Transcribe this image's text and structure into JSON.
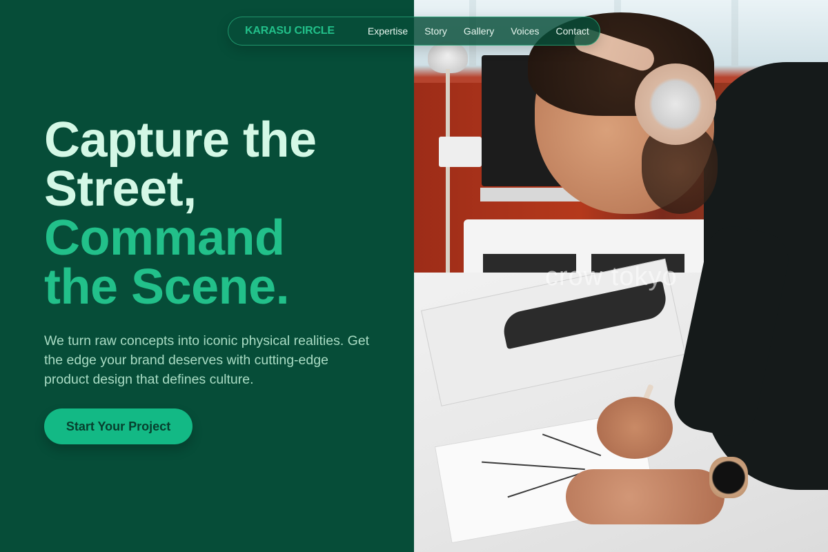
{
  "nav": {
    "brand": "KARASU CIRCLE",
    "links": [
      "Expertise",
      "Story",
      "Gallery",
      "Voices",
      "Contact"
    ]
  },
  "hero": {
    "title_line1": "Capture the",
    "title_line2": "Street,",
    "title_accent_line1": "Command",
    "title_accent_line2": "the Scene.",
    "description": "We turn raw concepts into iconic physical realities. Get the edge your brand deserves with cutting-edge product design that defines culture.",
    "cta_label": "Start Your Project"
  },
  "photo": {
    "watermark": "crow tokyo"
  },
  "colors": {
    "background": "#064d38",
    "accent": "#22c08a",
    "title": "#d4f8e6",
    "cta": "#13b985"
  }
}
